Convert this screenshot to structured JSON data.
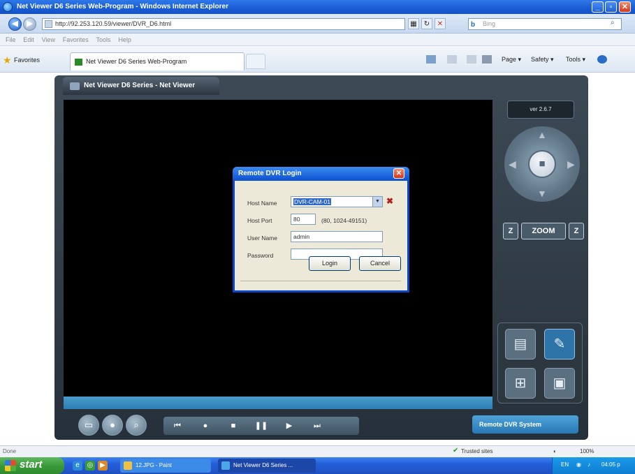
{
  "window": {
    "title": "Net Viewer D6 Series Web-Program - Windows Internet Explorer",
    "minimize": "_",
    "maximize": "▫",
    "close": "✕"
  },
  "address": {
    "url": "http://92.253.120.59/viewer/DVR_D6.html",
    "search_placeholder": "Bing",
    "search_brand": "b"
  },
  "menu": {
    "items": [
      "File",
      "Edit",
      "View",
      "Favorites",
      "Tools",
      "Help"
    ]
  },
  "favorites": {
    "label": "Favorites",
    "tab_title": "Net Viewer D6 Series Web-Program",
    "commands": {
      "page": "Page ▾",
      "safety": "Safety ▾",
      "tools": "Tools ▾"
    }
  },
  "viewer": {
    "app_title": "Net Viewer D6 Series - Net Viewer",
    "version": "ver 2.6.7",
    "zoom_label": "ZOOM",
    "zoom_out": "Z",
    "zoom_in": "Z",
    "remote_label": "Remote DVR System"
  },
  "login": {
    "title": "Remote DVR Login",
    "host_name_label": "Host Name",
    "host_name_value": "DVR-CAM-01",
    "host_port_label": "Host Port",
    "host_port_value": "80",
    "port_range": "(80, 1024-49151)",
    "user_name_label": "User Name",
    "user_name_value": "admin",
    "password_label": "Password",
    "password_value": "",
    "login_button": "Login",
    "cancel_button": "Cancel"
  },
  "status": {
    "left": "Done",
    "zone": "Trusted sites",
    "zoom": "100%"
  },
  "taskbar": {
    "start": "start",
    "tasks": [
      "12.JPG - Paint",
      "Net Viewer D6 Series ..."
    ],
    "tray_lang": "EN",
    "tray_time": "04:05 p"
  },
  "colors": {
    "title_bar": "#1a5cd6",
    "viewer_frame": "#2f3a44",
    "accent_blue": "#2878b4",
    "dialog_bg": "#ece9d8"
  }
}
